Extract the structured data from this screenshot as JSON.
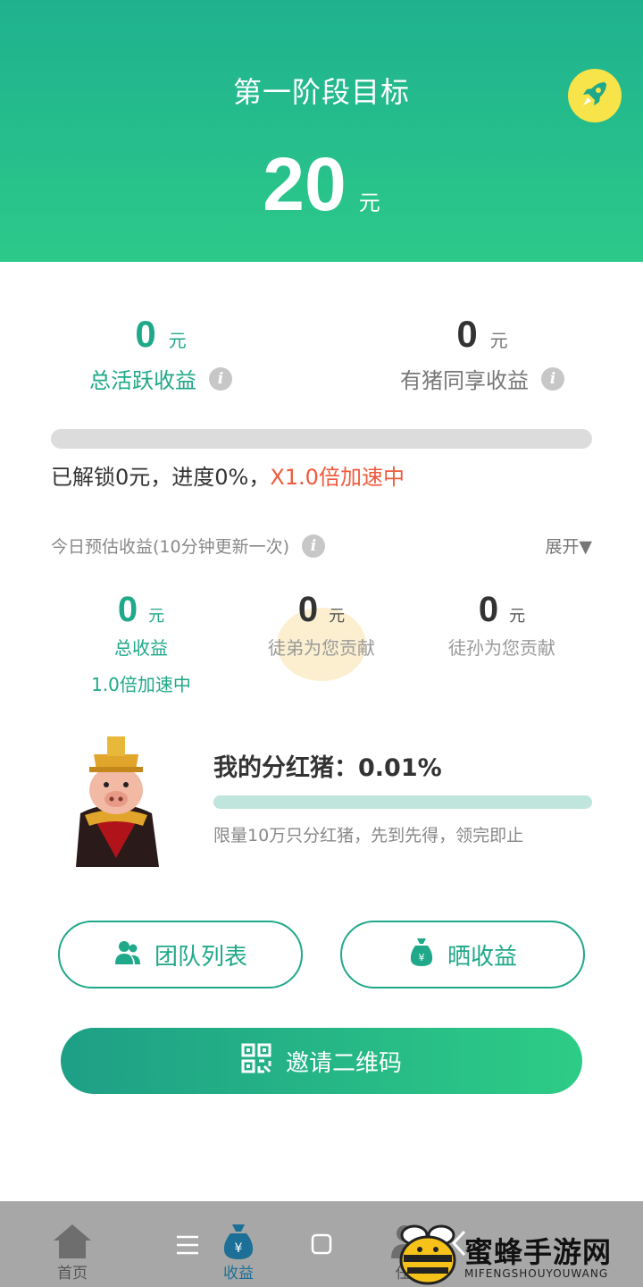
{
  "header": {
    "title": "第一阶段目标",
    "target_value": "20",
    "target_unit": "元"
  },
  "stats": {
    "active": {
      "value": "0",
      "unit": "元",
      "label": "总活跃收益"
    },
    "shared": {
      "value": "0",
      "unit": "元",
      "label": "有猪同享收益"
    }
  },
  "progress": {
    "fraction": 0,
    "text": "已解锁0元，进度0%，",
    "speed_text": "X1.0倍加速中"
  },
  "today": {
    "label": "今日预估收益(10分钟更新一次)",
    "expand": "展开▼",
    "total": {
      "value": "0",
      "unit": "元",
      "label": "总收益",
      "sub": "1.0倍加速中"
    },
    "disciple": {
      "value": "0",
      "unit": "元",
      "label": "徒弟为您贡献"
    },
    "grand_disciple": {
      "value": "0",
      "unit": "元",
      "label": "徒孙为您贡献"
    }
  },
  "dividend": {
    "title": "我的分红猪：0.01%",
    "fraction": 0.0001,
    "note": "限量10万只分红猪，先到先得，领完即止"
  },
  "buttons": {
    "team": "团队列表",
    "share": "晒收益",
    "invite": "邀请二维码"
  },
  "nav": {
    "home": "首页",
    "earnings": "收益",
    "task": "任"
  },
  "watermark": {
    "title": "蜜蜂手游网",
    "subtitle": "MIFENGSHOUYOUWANG"
  },
  "colors": {
    "primary": "#1fa889",
    "header_top": "#1fb18e",
    "accent_orange": "#f05a3c",
    "rocket_bg": "#f7e34a"
  }
}
